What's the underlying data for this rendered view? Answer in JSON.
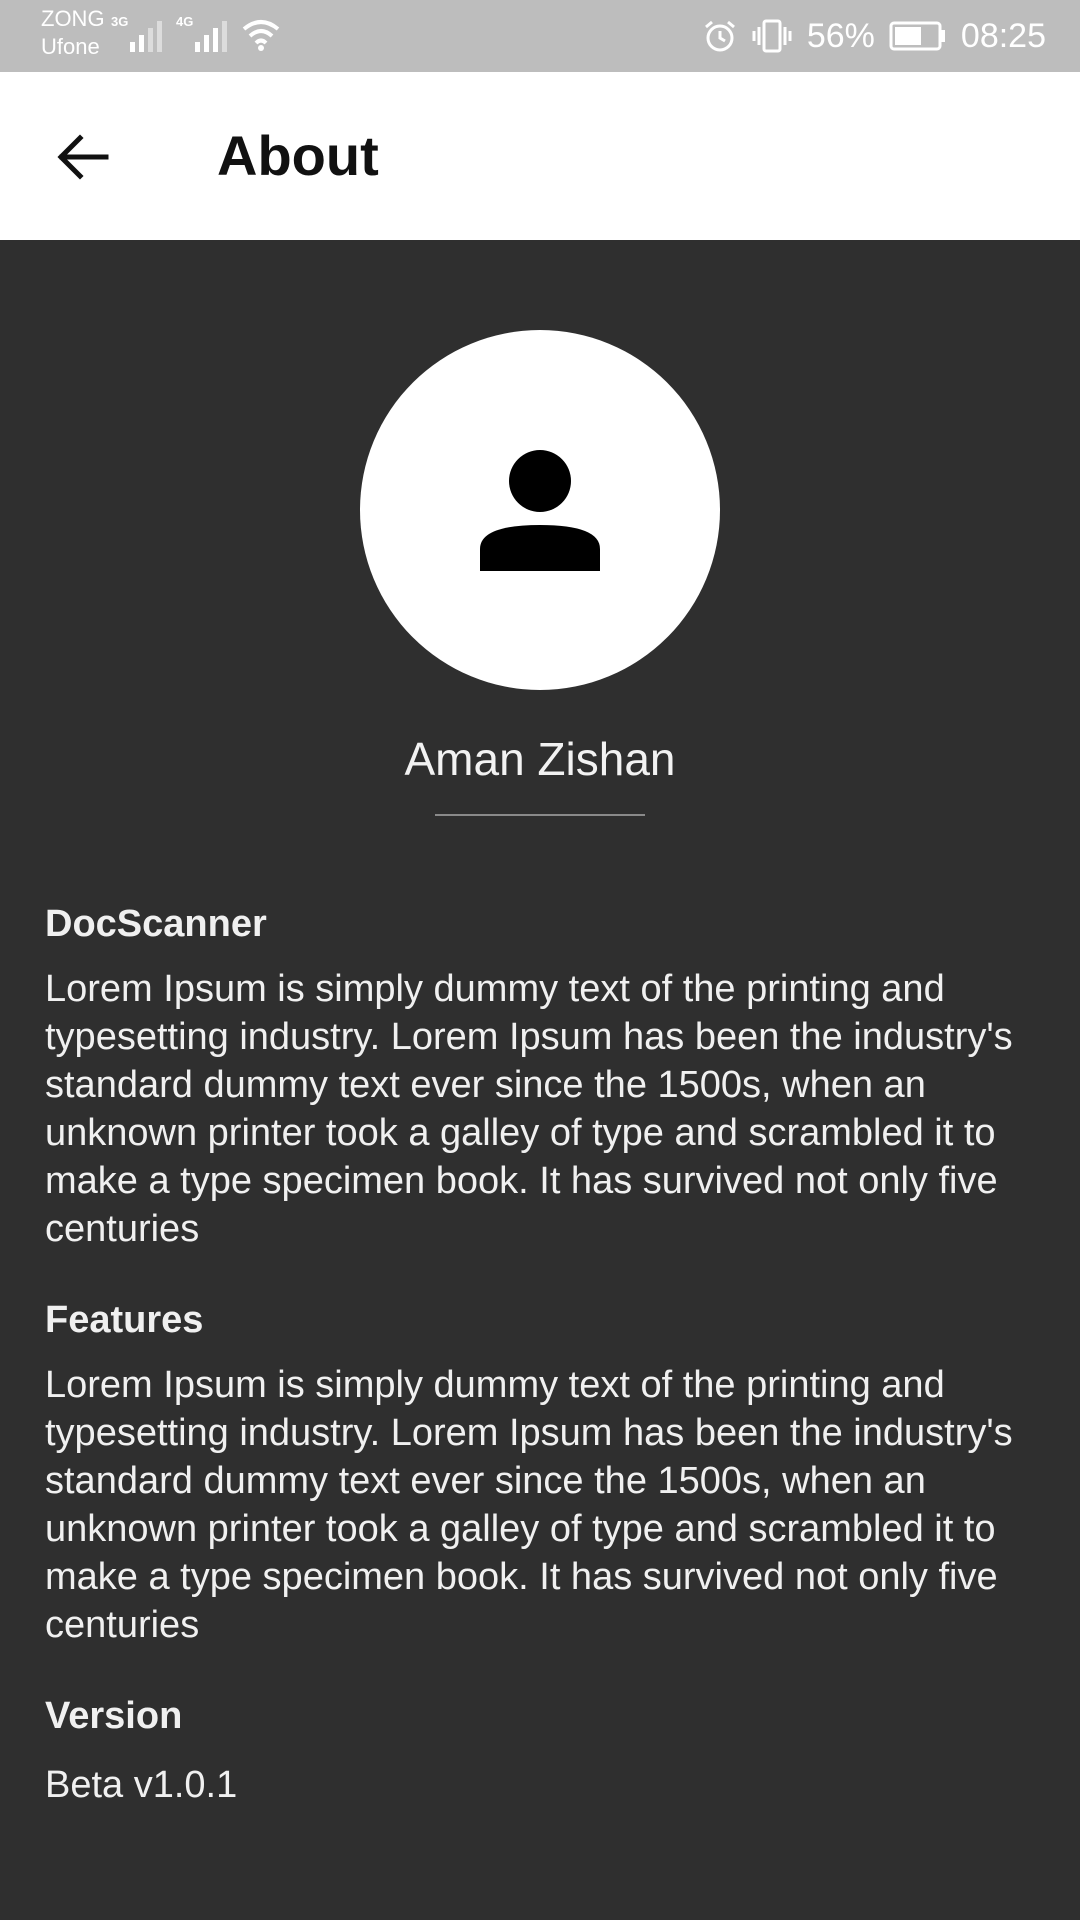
{
  "status_bar": {
    "carrier_primary": "ZONG",
    "carrier_secondary": "Ufone",
    "network_1": "3G",
    "network_2": "4G",
    "battery_percent": "56%",
    "time": "08:25",
    "icons": [
      "signal-icon",
      "wifi-icon",
      "alarm-icon",
      "vibrate-icon",
      "battery-icon"
    ]
  },
  "app_bar": {
    "title": "About",
    "back_icon": "arrow-back-icon"
  },
  "profile": {
    "name": "Aman Zishan",
    "avatar_icon": "person-icon"
  },
  "sections": {
    "app": {
      "heading": "DocScanner",
      "body": "Lorem Ipsum is simply dummy text of the printing and typesetting industry. Lorem Ipsum has been the industry's standard dummy text ever since the 1500s, when an unknown printer took a galley of type and scrambled it to make a type specimen book. It has survived not only five centuries"
    },
    "features": {
      "heading": "Features",
      "body": "Lorem Ipsum is simply dummy text of the printing and typesetting industry. Lorem Ipsum has been the industry's standard dummy text ever since the 1500s, when an unknown printer took a galley of type and scrambled it to make a type specimen book. It has survived not only five centuries"
    },
    "version": {
      "heading": "Version",
      "value": "Beta v1.0.1"
    }
  },
  "colors": {
    "background": "#2f2f2f",
    "app_bar": "#ffffff",
    "status_bar": "#bdbdbd",
    "text_light": "#f0f0f0"
  }
}
